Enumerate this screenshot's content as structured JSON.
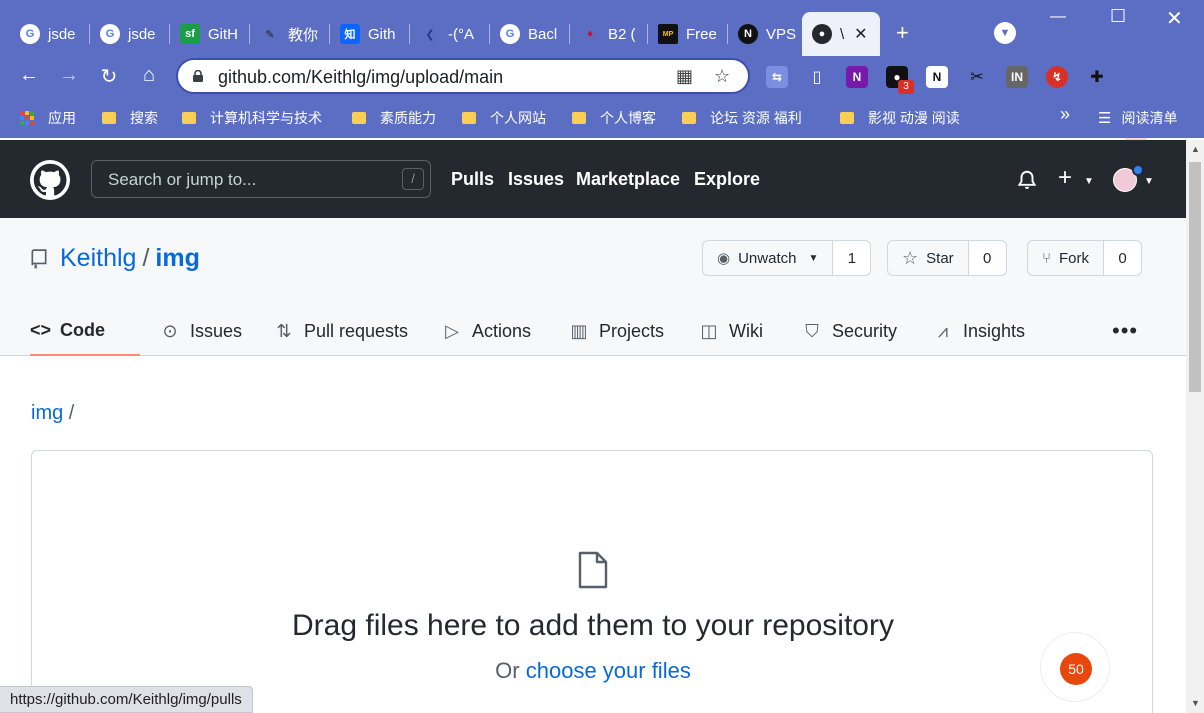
{
  "browser": {
    "tabs": [
      {
        "label": "jsde",
        "favicon": "google-g-icon"
      },
      {
        "label": "jsde",
        "favicon": "google-g-icon"
      },
      {
        "label": "GitH",
        "favicon": "segmentfault-icon"
      },
      {
        "label": "教你",
        "favicon": "pen-nib-icon"
      },
      {
        "label": "Gith",
        "favicon": "zhihu-icon"
      },
      {
        "label": "-(°A",
        "favicon": "arrow-logo-icon"
      },
      {
        "label": "Bacl",
        "favicon": "google-g-icon"
      },
      {
        "label": "B2 (",
        "favicon": "flame-icon"
      },
      {
        "label": "Free",
        "favicon": "meowpage-icon"
      },
      {
        "label": "VPS",
        "favicon": "n-logo-icon"
      },
      {
        "label": "\\",
        "favicon": "github-icon",
        "active": true
      }
    ],
    "url": "github.com/Keithlg/img/upload/main",
    "extension_badge": "3",
    "bookmarks": [
      "应用",
      "搜索",
      "计算机科学与技术",
      "素质能力",
      "个人网站",
      "个人博客",
      "论坛 资源 福利",
      "影视 动漫 阅读"
    ],
    "bookmarks_overflow": "»",
    "reading_list": "阅读清单",
    "status_url": "https://github.com/Keithlg/img/pulls"
  },
  "github": {
    "search_placeholder": "Search or jump to...",
    "search_shortcut": "/",
    "nav": [
      "Pulls",
      "Issues",
      "Marketplace",
      "Explore"
    ],
    "owner": "Keithlg",
    "separator": "/",
    "repo": "img",
    "watch": {
      "label": "Unwatch",
      "count": "1"
    },
    "star": {
      "label": "Star",
      "count": "0"
    },
    "fork": {
      "label": "Fork",
      "count": "0"
    },
    "tabs": [
      {
        "label": "Code",
        "icon": "code-icon"
      },
      {
        "label": "Issues",
        "icon": "issue-icon"
      },
      {
        "label": "Pull requests",
        "icon": "pull-request-icon"
      },
      {
        "label": "Actions",
        "icon": "play-icon"
      },
      {
        "label": "Projects",
        "icon": "project-icon"
      },
      {
        "label": "Wiki",
        "icon": "book-icon"
      },
      {
        "label": "Security",
        "icon": "shield-icon"
      },
      {
        "label": "Insights",
        "icon": "graph-icon"
      }
    ],
    "more_label": "•••",
    "breadcrumb_repo": "img",
    "breadcrumb_sep": "/",
    "drop_title": "Drag files here to add them to your repository",
    "drop_sub_prefix": "Or",
    "drop_sub_link": "choose your files"
  },
  "floating_counter": "50",
  "colors": {
    "chrome": "#5c6ec4",
    "github_header": "#24292f",
    "link": "#0969da",
    "tab_underline": "#fd8c73",
    "counter": "#e8470d"
  }
}
